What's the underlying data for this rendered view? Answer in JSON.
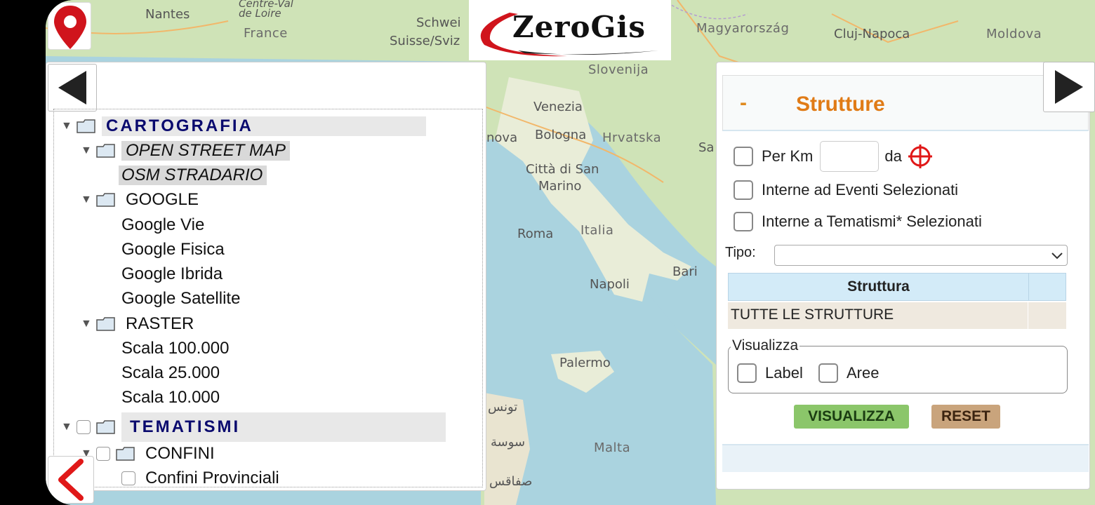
{
  "logo": {
    "text": "ZeroGis"
  },
  "map": {
    "labels": [
      "Nantes",
      "France",
      "Centre-Val",
      "de Loire",
      "Schwei",
      "Suisse/Sviz",
      "Magyarország",
      "Cluj-Napoca",
      "Moldova",
      "Slovenija",
      "Venezia",
      "Bologna",
      "Hrvatska",
      "nova",
      "Città di San",
      "Marino",
      "Roma",
      "Italia",
      "Bari",
      "Napoli",
      "Palermo",
      "Malta",
      "تونس",
      "سوسة",
      "صفاقس",
      "Sa"
    ]
  },
  "tree": {
    "cartografia": "CARTOGRAFIA",
    "osm": "OPEN STREET MAP",
    "osm_stradario": "OSM STRADARIO",
    "google": "GOOGLE",
    "google_vie": "Google Vie",
    "google_fisica": "Google Fisica",
    "google_ibrida": "Google Ibrida",
    "google_satellite": "Google Satellite",
    "raster": "RASTER",
    "scala_100": "Scala 100.000",
    "scala_25": "Scala 25.000",
    "scala_10": "Scala 10.000",
    "tematismi": "TEMATISMI",
    "confini": "CONFINI",
    "confini_provinciali": "Confini Provinciali"
  },
  "strutture": {
    "title": "Strutture",
    "minus": "-",
    "per_km": "Per Km",
    "km_value": "",
    "da": "da",
    "interne_eventi": "Interne ad Eventi Selezionati",
    "interne_tematismi": "Interne a Tematismi* Selezionati",
    "tipo_label": "Tipo:",
    "tipo_value": "",
    "table_header": "Struttura",
    "table_rows": [
      "TUTTE LE STRUTTURE"
    ],
    "visualizza_legend": "Visualizza",
    "label_cb": "Label",
    "aree_cb": "Aree",
    "btn_visualizza": "VISUALIZZA",
    "btn_reset": "RESET"
  },
  "colors": {
    "accent": "#e07b16",
    "header_blue": "#0a0a6e",
    "visualizza_btn": "#8bc66a",
    "reset_btn": "#c9a47c",
    "pin_red": "#d0141c"
  }
}
